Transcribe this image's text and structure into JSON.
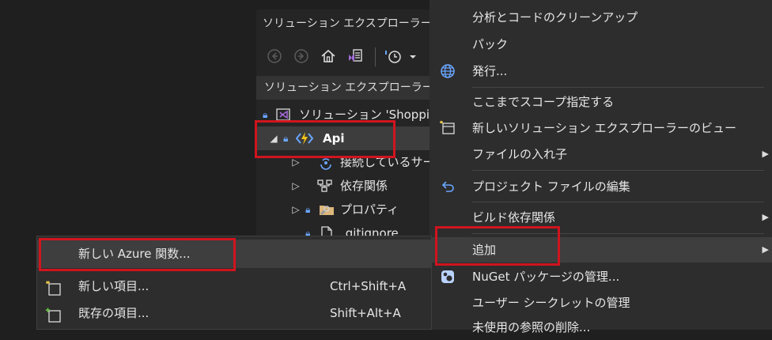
{
  "solution_explorer": {
    "title": "ソリューション エクスプローラー",
    "title_dots": "⁘",
    "search_placeholder": "ソリューション エクスプローラーの",
    "tree": [
      {
        "label": "ソリューション 'Shopping"
      },
      {
        "label": "Api"
      },
      {
        "label": "接続しているサービス"
      },
      {
        "label": "依存関係"
      },
      {
        "label": "プロパティ"
      },
      {
        "label": ".gitignore"
      }
    ]
  },
  "context_menu": {
    "items": [
      {
        "label": "分析とコードのクリーンアップ"
      },
      {
        "label": "パック"
      },
      {
        "label": "発行..."
      },
      {
        "label": "ここまでスコープ指定する"
      },
      {
        "label": "新しいソリューション エクスプローラーのビュー"
      },
      {
        "label": "ファイルの入れ子"
      },
      {
        "label": "プロジェクト ファイルの編集"
      },
      {
        "label": "ビルド依存関係"
      },
      {
        "label": "追加"
      },
      {
        "label": "NuGet パッケージの管理..."
      },
      {
        "label": "ユーザー シークレットの管理"
      },
      {
        "label": "未使用の参照の削除..."
      }
    ]
  },
  "add_submenu": {
    "items": [
      {
        "label": "新しい Azure 関数...",
        "shortcut": ""
      },
      {
        "label": "新しい項目...",
        "shortcut": "Ctrl+Shift+A"
      },
      {
        "label": "既存の項目...",
        "shortcut": "Shift+Alt+A"
      }
    ]
  },
  "colors": {
    "highlight_box": "#d0141e",
    "accent": "#6aa6ff",
    "vs_purple": "#a46bd8"
  }
}
